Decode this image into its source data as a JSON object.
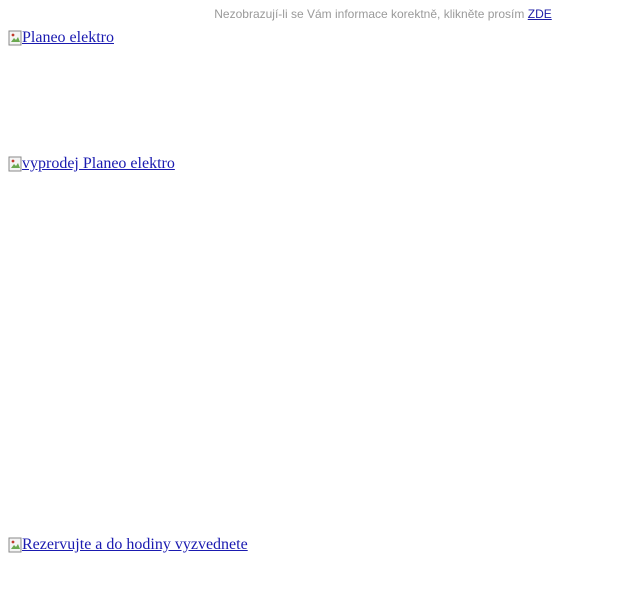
{
  "notice": {
    "text": "Nezobrazují-li se Vám informace korektně, klikněte prosím",
    "link_label": "ZDE"
  },
  "images": {
    "logo_alt": "Planeo elektro",
    "sale_alt": "vyprodej Planeo elektro",
    "reserve_alt": "Rezervujte a do hodiny vyzvednete"
  },
  "icons": {
    "broken_image": "broken-image-icon"
  },
  "colors": {
    "link": "#1a1ab0",
    "notice_text": "#9a9a9a"
  }
}
